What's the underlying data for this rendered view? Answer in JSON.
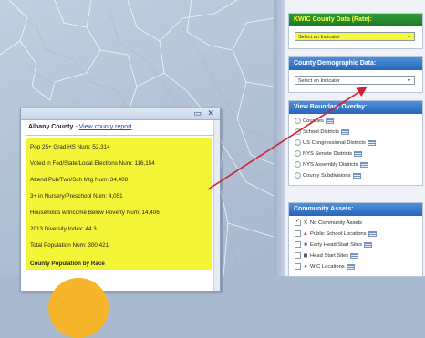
{
  "popup": {
    "buttons": "▭ ✕",
    "county_name": "Albany County",
    "separator": " - ",
    "county_link": "View county report",
    "stats": [
      "Pop 25+ Grad HS Num: 52,314",
      "Voted in Fed/State/Local Elections Num: 116,154",
      "Attend Pub/Twn/Sch Mtg Num: 34,408",
      "3+ in Nursery/Preschool Num: 4,051",
      "Households w/Income Below Poverty Num: 14,406",
      "2013 Diversity Index: 44.3",
      "Total Population Num: 300,421"
    ],
    "race_title": "County Population by Race"
  },
  "panel": {
    "kwic": {
      "title": "KWIC County Data (Rate):",
      "select_value": "Select an Indicator"
    },
    "demographic": {
      "title": "County Demographic Data:",
      "select_value": "Select an Indicator"
    },
    "boundary": {
      "title": "View Boundary Overlay:",
      "options": [
        "Counties",
        "School Districts",
        "US Congressional Districts",
        "NYS Senate Districts",
        "NYS Assembly Districts",
        "County Subdivisions"
      ]
    },
    "assets": {
      "title": "Community Assets:",
      "items": [
        {
          "label": "No Community Assets",
          "checked": true,
          "icon": "no-assets-icon"
        },
        {
          "label": "Public School Locations",
          "checked": false,
          "icon": "school-icon"
        },
        {
          "label": "Early Head Start Sites",
          "checked": false,
          "icon": "early-head-start-icon"
        },
        {
          "label": "Head Start Sites",
          "checked": false,
          "icon": "head-start-icon"
        },
        {
          "label": "WIC Locations",
          "checked": false,
          "icon": "wic-icon"
        }
      ]
    }
  },
  "colors": {
    "highlight": "#f4f437",
    "arrow": "#cc2233",
    "header_blue": "#2766b8",
    "header_green": "#1c7a27"
  }
}
